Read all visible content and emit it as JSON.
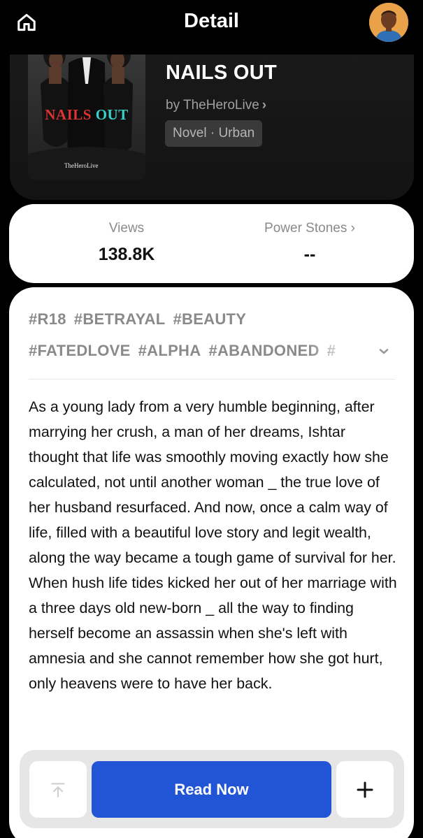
{
  "header": {
    "title": "Detail",
    "home_icon": "home-icon",
    "avatar_icon": "user-avatar"
  },
  "book": {
    "cover": {
      "title_word1": "NAILS",
      "title_word2": "OUT",
      "author": "TheHeroLive"
    },
    "title": "NAILS OUT",
    "author_line": "by TheHeroLive",
    "author_chevron": "›",
    "genre": "Novel · Urban"
  },
  "stats": {
    "views_label": "Views",
    "views_value": "138.8K",
    "power_stones_label": "Power Stones ›",
    "power_stones_value": "--"
  },
  "tags": {
    "row1": [
      "#R18",
      "#BETRAYAL",
      "#BEAUTY"
    ],
    "row2": [
      "#FATEDLOVE",
      "#ALPHA",
      "#ABANDONED",
      "#"
    ]
  },
  "synopsis": "As a young lady from a very humble beginning, after marrying her crush, a man of her dreams, Ishtar thought that life was smoothly moving exactly how she calculated, not until another woman _ the true love of her husband resurfaced. And now, once a calm way of life, filled with a beautiful love story and legit wealth, along the way became a tough game of survival for her. When hush life tides kicked her out of her marriage with a three days old new-born _ all the way to finding herself become an assassin when she's left with amnesia and she cannot remember how she got hurt, only heavens were to have her back.",
  "actions": {
    "read_now_label": "Read Now",
    "add_label": "+",
    "back_to_top_icon": "arrow-up-to-line-icon"
  },
  "colors": {
    "background": "#000000",
    "card": "#ffffff",
    "accent": "#2255d6",
    "tag_gray": "#8a8a8a",
    "cover_red": "#dd3333",
    "cover_teal": "#39d0c8"
  }
}
